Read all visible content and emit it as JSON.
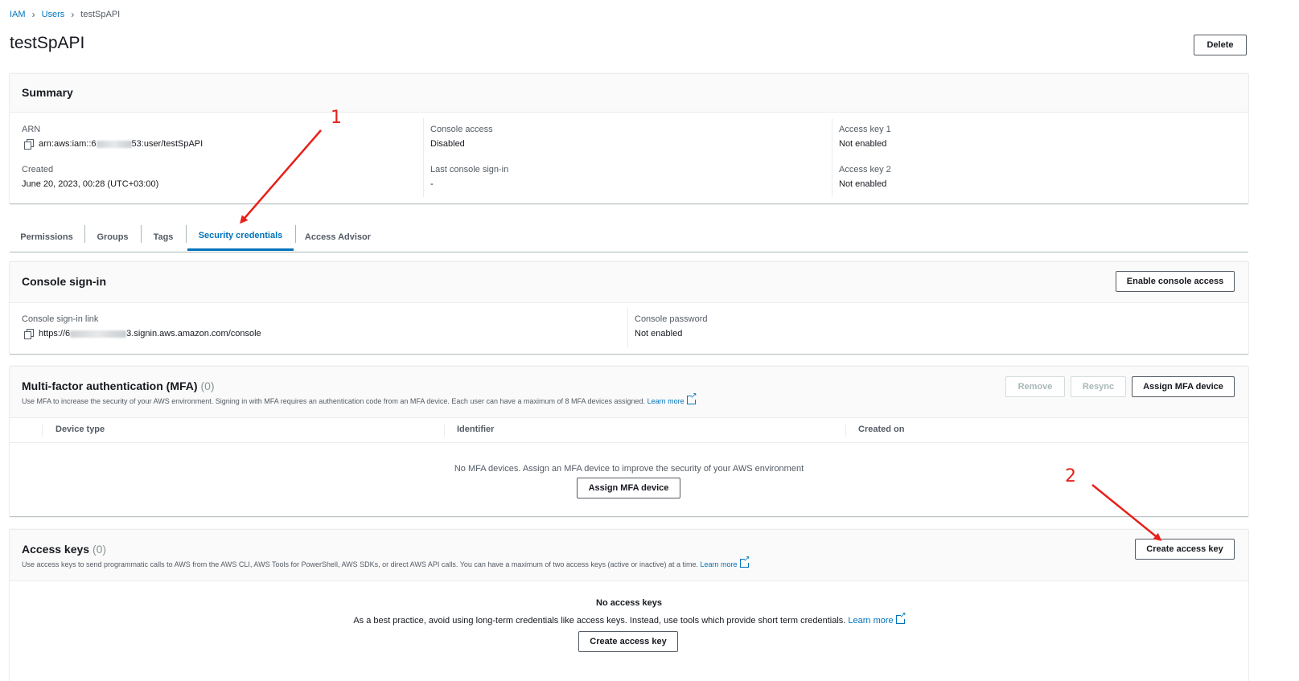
{
  "breadcrumb": {
    "root": "IAM",
    "section": "Users",
    "current": "testSpAPI"
  },
  "page": {
    "title": "testSpAPI",
    "delete_label": "Delete"
  },
  "summary": {
    "title": "Summary",
    "arn_label": "ARN",
    "arn_prefix": "arn:aws:iam::6",
    "arn_suffix": "53:user/testSpAPI",
    "created_label": "Created",
    "created_value": "June 20, 2023, 00:28 (UTC+03:00)",
    "console_access_label": "Console access",
    "console_access_value": "Disabled",
    "last_signin_label": "Last console sign-in",
    "last_signin_value": "-",
    "key1_label": "Access key 1",
    "key1_value": "Not enabled",
    "key2_label": "Access key 2",
    "key2_value": "Not enabled"
  },
  "tabs": [
    {
      "label": "Permissions"
    },
    {
      "label": "Groups"
    },
    {
      "label": "Tags"
    },
    {
      "label": "Security credentials"
    },
    {
      "label": "Access Advisor"
    }
  ],
  "console_signin": {
    "title": "Console sign-in",
    "enable_button": "Enable console access",
    "link_label": "Console sign-in link",
    "link_prefix": "https://6",
    "link_suffix": "3.signin.aws.amazon.com/console",
    "password_label": "Console password",
    "password_value": "Not enabled"
  },
  "mfa": {
    "title": "Multi-factor authentication (MFA)",
    "count": "(0)",
    "description": "Use MFA to increase the security of your AWS environment. Signing in with MFA requires an authentication code from an MFA device. Each user can have a maximum of 8 MFA devices assigned.",
    "learn_more": "Learn more",
    "remove_button": "Remove",
    "resync_button": "Resync",
    "assign_button": "Assign MFA device",
    "columns": [
      "Device type",
      "Identifier",
      "Created on"
    ],
    "empty_text": "No MFA devices. Assign an MFA device to improve the security of your AWS environment",
    "empty_button": "Assign MFA device"
  },
  "access_keys": {
    "title": "Access keys",
    "count": "(0)",
    "description": "Use access keys to send programmatic calls to AWS from the AWS CLI, AWS Tools for PowerShell, AWS SDKs, or direct AWS API calls. You can have a maximum of two access keys (active or inactive) at a time.",
    "learn_more": "Learn more",
    "create_button": "Create access key",
    "empty_title": "No access keys",
    "empty_text": "As a best practice, avoid using long-term credentials like access keys. Instead, use tools which provide short term credentials.",
    "empty_learn_more": "Learn more",
    "empty_button": "Create access key"
  },
  "annotations": {
    "step1": "1",
    "step2": "2"
  },
  "colors": {
    "link": "#0073bb",
    "annotation": "#e8201a",
    "text": "#16191f",
    "muted": "#545b64"
  }
}
